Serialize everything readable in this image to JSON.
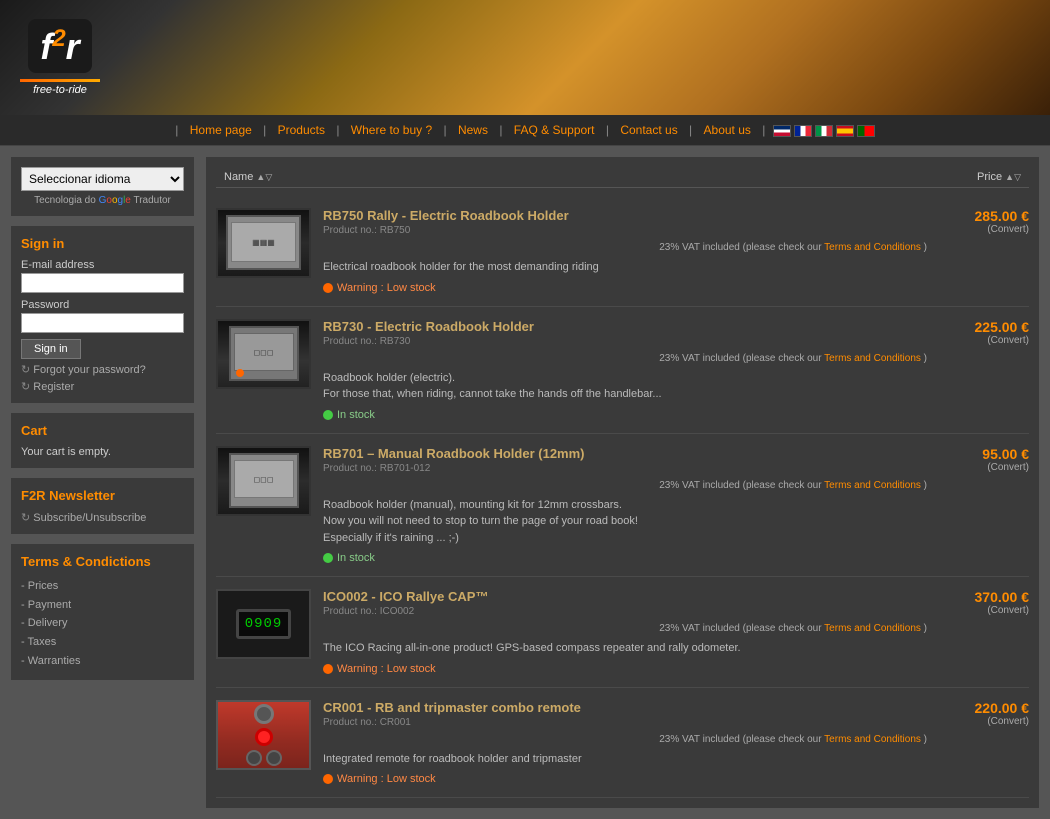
{
  "header": {
    "logo_main": "f",
    "logo_sub": "2",
    "logo_r": "r",
    "tagline": "free-to-ride"
  },
  "nav": {
    "items": [
      {
        "label": "Home page",
        "href": "#"
      },
      {
        "label": "Products",
        "href": "#"
      },
      {
        "label": "Where to buy ?",
        "href": "#"
      },
      {
        "label": "News",
        "href": "#"
      },
      {
        "label": "FAQ & Support",
        "href": "#"
      },
      {
        "label": "Contact us",
        "href": "#"
      },
      {
        "label": "About us",
        "href": "#"
      }
    ]
  },
  "sidebar": {
    "lang_label": "Seleccionar idioma",
    "google_label": "Tecnologia do",
    "google_brand": "Google",
    "translate_word": "Tradutor",
    "signin_title": "Sign in",
    "email_label": "E-mail address",
    "email_placeholder": "",
    "password_label": "Password",
    "password_placeholder": "",
    "signin_btn": "Sign in",
    "forgot_label": "Forgot your password?",
    "register_label": "Register",
    "cart_title": "Cart",
    "cart_empty": "Your cart is empty.",
    "newsletter_title": "F2R Newsletter",
    "newsletter_link": "Subscribe/Unsubscribe",
    "terms_title": "Terms & Condictions",
    "terms_items": [
      {
        "label": "Prices",
        "href": "#"
      },
      {
        "label": "Payment",
        "href": "#"
      },
      {
        "label": "Delivery",
        "href": "#"
      },
      {
        "label": "Taxes",
        "href": "#"
      },
      {
        "label": "Warranties",
        "href": "#"
      }
    ]
  },
  "content": {
    "sort_name": "Name",
    "sort_name_arrow": "▲▽",
    "sort_price": "Price",
    "sort_price_arrow": "▲▽",
    "products": [
      {
        "id": "rb750",
        "name": "RB750 Rally - Electric Roadbook Holder",
        "product_no": "Product no.: RB750",
        "price": "285.00 €",
        "convert": "(Convert)",
        "vat": "23% VAT included (please check our",
        "vat_link": "Terms and Conditions",
        "desc": "Electrical roadbook holder for the most demanding riding",
        "stock_type": "low",
        "stock_text": "Warning : Low stock"
      },
      {
        "id": "rb730",
        "name": "RB730 - Electric Roadbook Holder",
        "product_no": "Product no.: RB730",
        "price": "225.00 €",
        "convert": "(Convert)",
        "vat": "23% VAT included (please check our",
        "vat_link": "Terms and Conditions",
        "desc": "Roadbook holder (electric).\nFor those that, when riding, cannot take the hands off the handlebar...",
        "stock_type": "in",
        "stock_text": "In stock"
      },
      {
        "id": "rb701",
        "name": "RB701 – Manual Roadbook Holder (12mm)",
        "product_no": "Product no.: RB701-012",
        "price": "95.00 €",
        "convert": "(Convert)",
        "vat": "23% VAT included (please check our",
        "vat_link": "Terms and Conditions",
        "desc": "Roadbook holder (manual), mounting kit for 12mm crossbars.\nNow you will not need to stop to turn the page of your road book!\nEspecially if it's raining ... ;-)",
        "stock_type": "in",
        "stock_text": "In stock"
      },
      {
        "id": "ico002",
        "name": "ICO002 - ICO Rallye CAP™",
        "product_no": "Product no.: ICO002",
        "price": "370.00 €",
        "convert": "(Convert)",
        "vat": "23% VAT included (please check our",
        "vat_link": "Terms and Conditions",
        "desc": "The ICO Racing all-in-one product! GPS-based compass repeater and rally odometer.",
        "stock_type": "low",
        "stock_text": "Warning : Low stock"
      },
      {
        "id": "cr001",
        "name": "CR001 - RB and tripmaster combo remote",
        "product_no": "Product no.: CR001",
        "price": "220.00 €",
        "convert": "(Convert)",
        "vat": "23% VAT included (please check our",
        "vat_link": "Terms and Conditions",
        "desc": "Integrated remote for roadbook holder and tripmaster",
        "stock_type": "low",
        "stock_text": "Warning : Low stock"
      }
    ]
  }
}
